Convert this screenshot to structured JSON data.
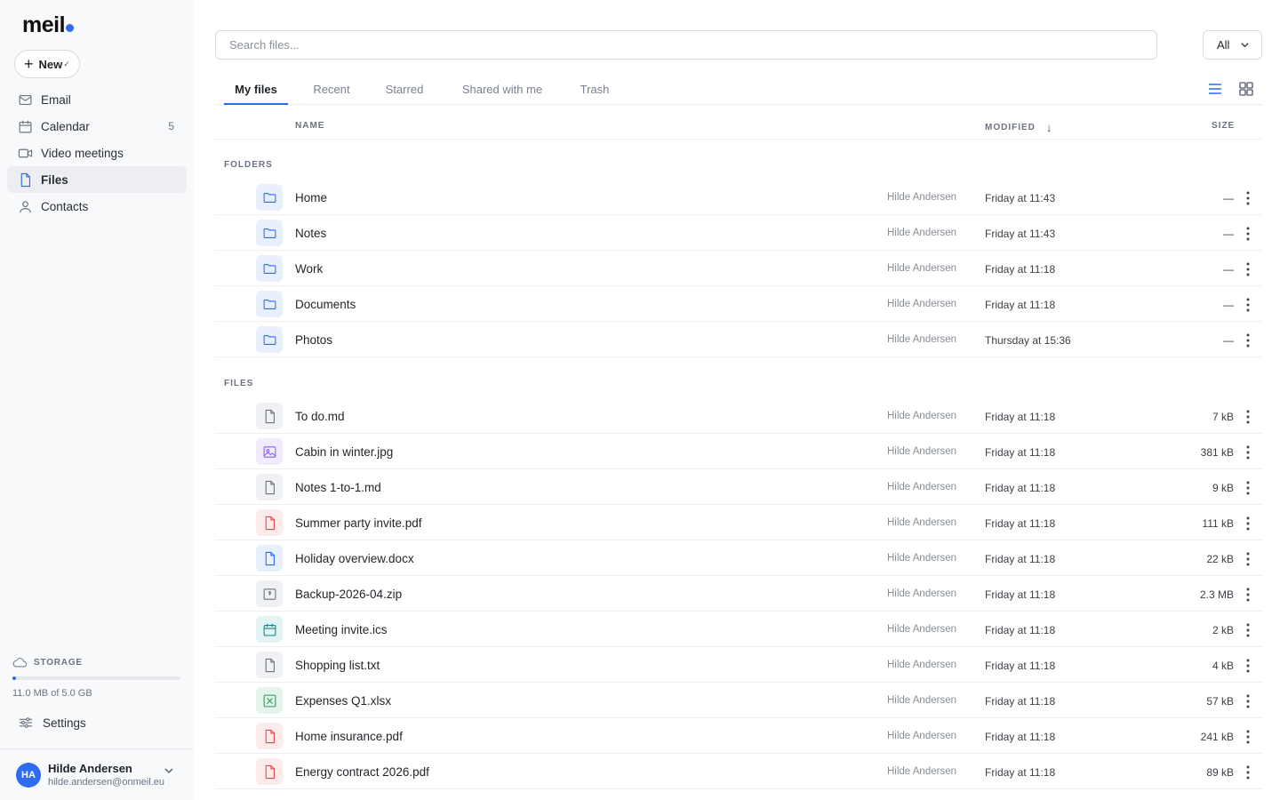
{
  "app": {
    "logo": "meil"
  },
  "sidebar": {
    "new_label": "New",
    "items": [
      {
        "label": "Email",
        "icon": "mail-icon",
        "count": ""
      },
      {
        "label": "Calendar",
        "icon": "calendar-icon",
        "count": "5"
      },
      {
        "label": "Video meetings",
        "icon": "video-icon",
        "count": ""
      },
      {
        "label": "Files",
        "icon": "file-icon",
        "count": "",
        "active": true
      },
      {
        "label": "Contacts",
        "icon": "person-icon",
        "count": ""
      }
    ],
    "storage": {
      "label": "STORAGE",
      "text": "11.0 MB of 5.0 GB",
      "used_fraction": 0.0022
    },
    "settings_label": "Settings",
    "user": {
      "initials": "HA",
      "name": "Hilde Andersen",
      "email": "hilde.andersen@onmeil.eu"
    }
  },
  "search": {
    "placeholder": "Search files..."
  },
  "filter": {
    "value": "All"
  },
  "tabs": [
    {
      "label": "My files",
      "active": true
    },
    {
      "label": "Recent"
    },
    {
      "label": "Starred"
    },
    {
      "label": "Shared with me"
    },
    {
      "label": "Trash"
    }
  ],
  "columns": {
    "name": "NAME",
    "modified": "MODIFIED",
    "size": "SIZE"
  },
  "sections": {
    "folders": "FOLDERS",
    "files": "FILES"
  },
  "folders": [
    {
      "name": "Home",
      "owner": "Hilde Andersen",
      "modified": "Friday at 11:43",
      "size": "—"
    },
    {
      "name": "Notes",
      "owner": "Hilde Andersen",
      "modified": "Friday at 11:43",
      "size": "—"
    },
    {
      "name": "Work",
      "owner": "Hilde Andersen",
      "modified": "Friday at 11:18",
      "size": "—"
    },
    {
      "name": "Documents",
      "owner": "Hilde Andersen",
      "modified": "Friday at 11:18",
      "size": "—"
    },
    {
      "name": "Photos",
      "owner": "Hilde Andersen",
      "modified": "Thursday at 15:36",
      "size": "—"
    }
  ],
  "files": [
    {
      "name": "To do.md",
      "owner": "Hilde Andersen",
      "modified": "Friday at 11:18",
      "size": "7 kB",
      "type": "doc"
    },
    {
      "name": "Cabin in winter.jpg",
      "owner": "Hilde Andersen",
      "modified": "Friday at 11:18",
      "size": "381 kB",
      "type": "image"
    },
    {
      "name": "Notes 1-to-1.md",
      "owner": "Hilde Andersen",
      "modified": "Friday at 11:18",
      "size": "9 kB",
      "type": "doc"
    },
    {
      "name": "Summer party invite.pdf",
      "owner": "Hilde Andersen",
      "modified": "Friday at 11:18",
      "size": "111 kB",
      "type": "pdf"
    },
    {
      "name": "Holiday overview.docx",
      "owner": "Hilde Andersen",
      "modified": "Friday at 11:18",
      "size": "22 kB",
      "type": "word"
    },
    {
      "name": "Backup-2026-04.zip",
      "owner": "Hilde Andersen",
      "modified": "Friday at 11:18",
      "size": "2.3 MB",
      "type": "zip"
    },
    {
      "name": "Meeting invite.ics",
      "owner": "Hilde Andersen",
      "modified": "Friday at 11:18",
      "size": "2 kB",
      "type": "calendar"
    },
    {
      "name": "Shopping list.txt",
      "owner": "Hilde Andersen",
      "modified": "Friday at 11:18",
      "size": "4 kB",
      "type": "doc"
    },
    {
      "name": "Expenses Q1.xlsx",
      "owner": "Hilde Andersen",
      "modified": "Friday at 11:18",
      "size": "57 kB",
      "type": "sheet"
    },
    {
      "name": "Home insurance.pdf",
      "owner": "Hilde Andersen",
      "modified": "Friday at 11:18",
      "size": "241 kB",
      "type": "pdf"
    },
    {
      "name": "Energy contract 2026.pdf",
      "owner": "Hilde Andersen",
      "modified": "Friday at 11:18",
      "size": "89 kB",
      "type": "pdf"
    }
  ],
  "colors": {
    "accent": "#2f6bf0",
    "pdf": "#e5484d",
    "sheet": "#1f9d55",
    "image": "#8b5cf6",
    "calendar": "#0d8a8a"
  }
}
